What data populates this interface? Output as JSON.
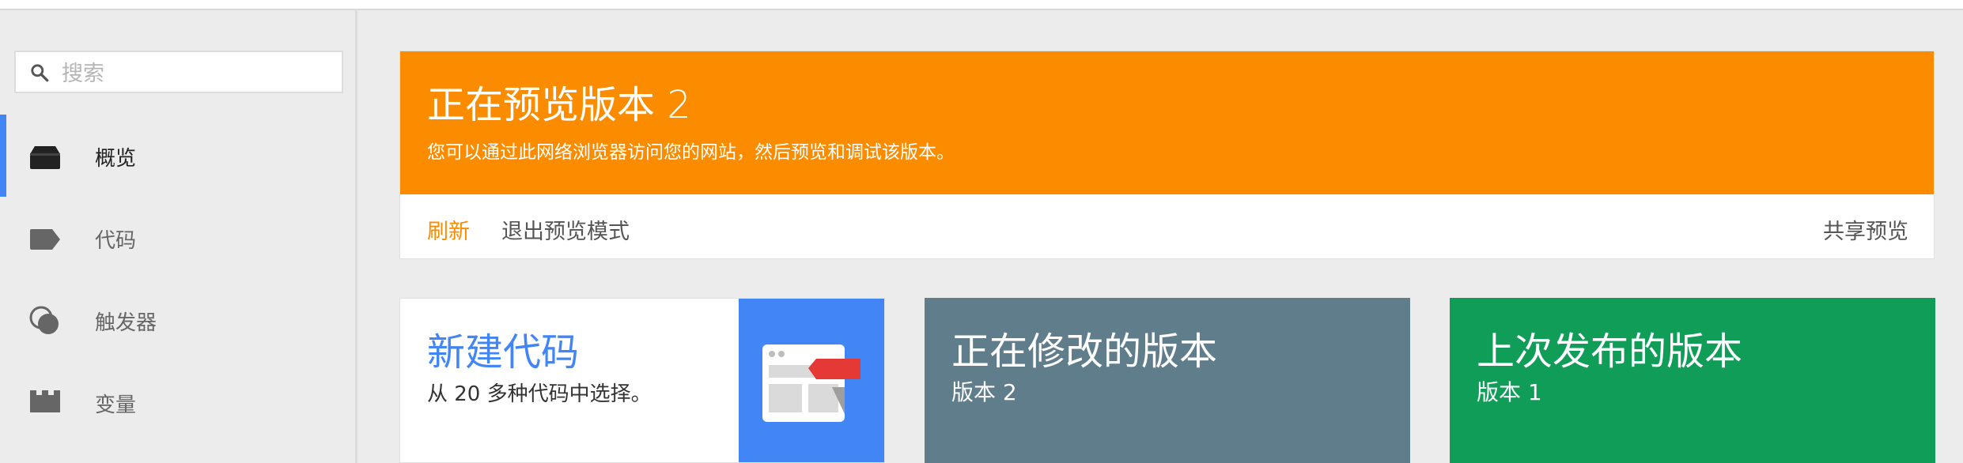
{
  "search": {
    "placeholder": "搜索",
    "value": ""
  },
  "sidebar": {
    "items": [
      {
        "label": "概览",
        "icon": "overview-icon",
        "active": true
      },
      {
        "label": "代码",
        "icon": "tag-icon",
        "active": false
      },
      {
        "label": "触发器",
        "icon": "trigger-icon",
        "active": false
      },
      {
        "label": "变量",
        "icon": "variable-icon",
        "active": false
      }
    ]
  },
  "preview_banner": {
    "title": "正在预览版本 2",
    "description": "您可以通过此网络浏览器访问您的网站，然后预览和调试该版本。",
    "refresh_label": "刷新",
    "exit_label": "退出预览模式",
    "share_label": "共享预览"
  },
  "cards": {
    "new_tag": {
      "title": "新建代码",
      "subtitle": "从 20 多种代码中选择。"
    },
    "editing_version": {
      "title": "正在修改的版本",
      "subtitle": "版本 2"
    },
    "last_published": {
      "title": "上次发布的版本",
      "subtitle": "版本 1"
    }
  },
  "colors": {
    "accent_blue": "#4285f4",
    "banner_orange": "#fb8c00",
    "card_gray": "#607d8b",
    "card_green": "#0f9d58"
  }
}
